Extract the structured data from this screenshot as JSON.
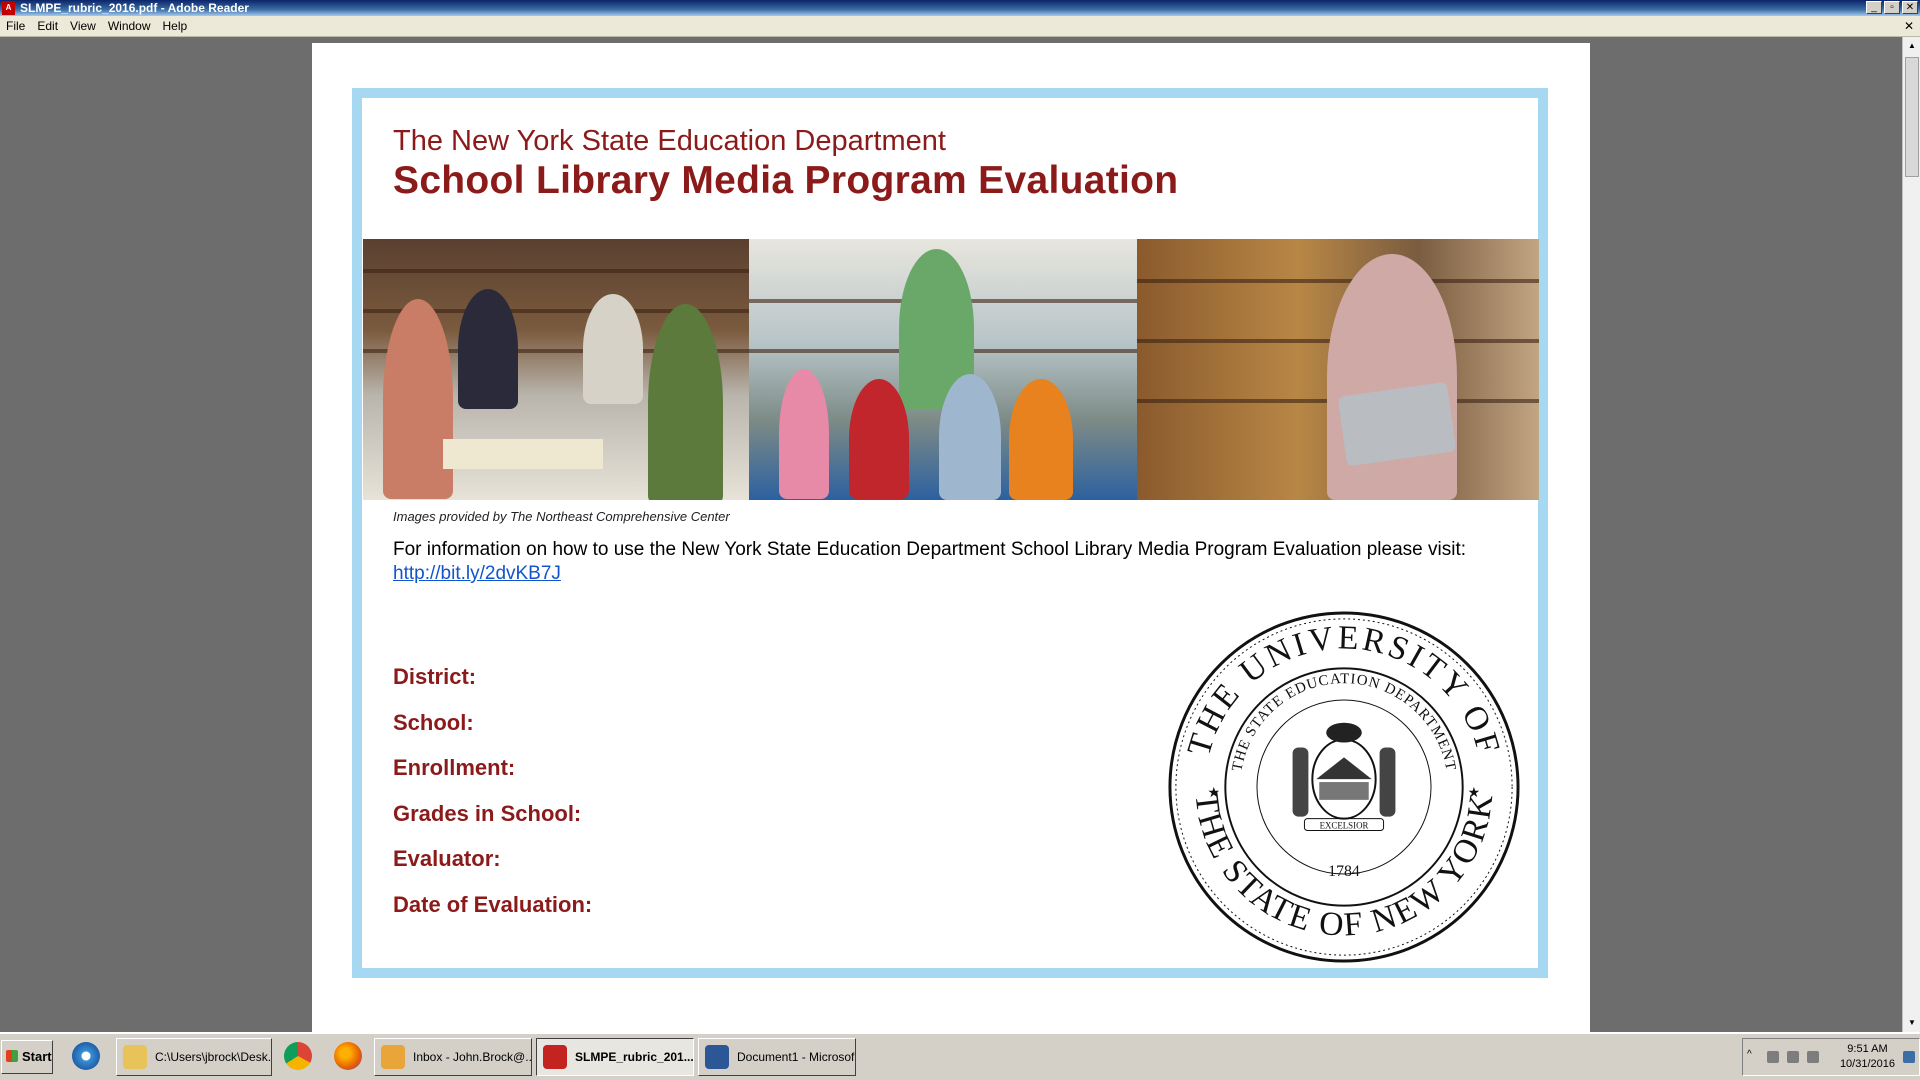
{
  "window": {
    "title": "SLMPE_rubric_2016.pdf - Adobe Reader",
    "controls": [
      "_",
      "▫",
      "✕"
    ]
  },
  "menu": {
    "items": [
      "File",
      "Edit",
      "View",
      "Window",
      "Help"
    ],
    "close_doc": "✕"
  },
  "document": {
    "department": "The New York State Education Department",
    "title": "School Library Media Program Evaluation",
    "image_caption": "Images provided by The Northeast Comprehensive Center",
    "info_text": "For information on how to use the New York State Education Department School Library Media Program Evaluation please visit:",
    "info_link": "http://bit.ly/2dvKB7J",
    "fields": [
      "District:",
      "School:",
      "Enrollment:",
      "Grades in School:",
      "Evaluator:",
      "Date of Evaluation:"
    ],
    "seal": {
      "outer_text": "THE UNIVERSITY OF",
      "outer_bottom_text": "THE STATE OF NEW YORK",
      "inner_text": "THE STATE EDUCATION DEPARTMENT",
      "motto": "EXCELSIOR",
      "year": "1784"
    }
  },
  "taskbar": {
    "start_label": "Start",
    "items": [
      {
        "label": "C:\\Users\\jbrock\\Desk...",
        "icon": "folder-icon"
      },
      {
        "label": "Inbox - John.Brock@...",
        "icon": "outlook-icon"
      },
      {
        "label": "SLMPE_rubric_201...",
        "icon": "pdf-icon",
        "active": true
      },
      {
        "label": "Document1 - Microsof...",
        "icon": "word-icon"
      }
    ],
    "clock_time": "9:51 AM",
    "clock_date": "10/31/2016"
  },
  "colors": {
    "maroon": "#8b1a1a",
    "frame_blue": "#a6d8f2",
    "link_blue": "#1155cc"
  }
}
